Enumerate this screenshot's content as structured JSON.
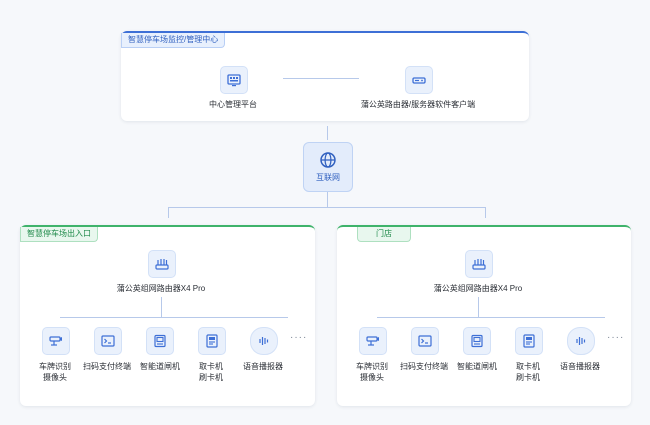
{
  "top_panel": {
    "tag": "智慧停车场监控/管理中心",
    "center_platform": "中心管理平台",
    "client": "蒲公英路由器/服务器软件客户端"
  },
  "internet": {
    "label": "互联网"
  },
  "left_site": {
    "tag": "智慧停车场出入口",
    "router": "蒲公英组网路由器X4 Pro",
    "devices": [
      {
        "line1": "车牌识别",
        "line2": "摄像头"
      },
      {
        "line1": "扫码支付终端",
        "line2": ""
      },
      {
        "line1": "智能道闸机",
        "line2": ""
      },
      {
        "line1": "取卡机",
        "line2": "刷卡机"
      },
      {
        "line1": "语音播报器",
        "line2": ""
      }
    ],
    "more": "····"
  },
  "right_site": {
    "tag": "门店",
    "router": "蒲公英组网路由器X4 Pro",
    "devices": [
      {
        "line1": "车牌识别",
        "line2": "摄像头"
      },
      {
        "line1": "扫码支付终端",
        "line2": ""
      },
      {
        "line1": "智能道闸机",
        "line2": ""
      },
      {
        "line1": "取卡机",
        "line2": "刷卡机"
      },
      {
        "line1": "语音播报器",
        "line2": ""
      }
    ],
    "more": "····"
  }
}
